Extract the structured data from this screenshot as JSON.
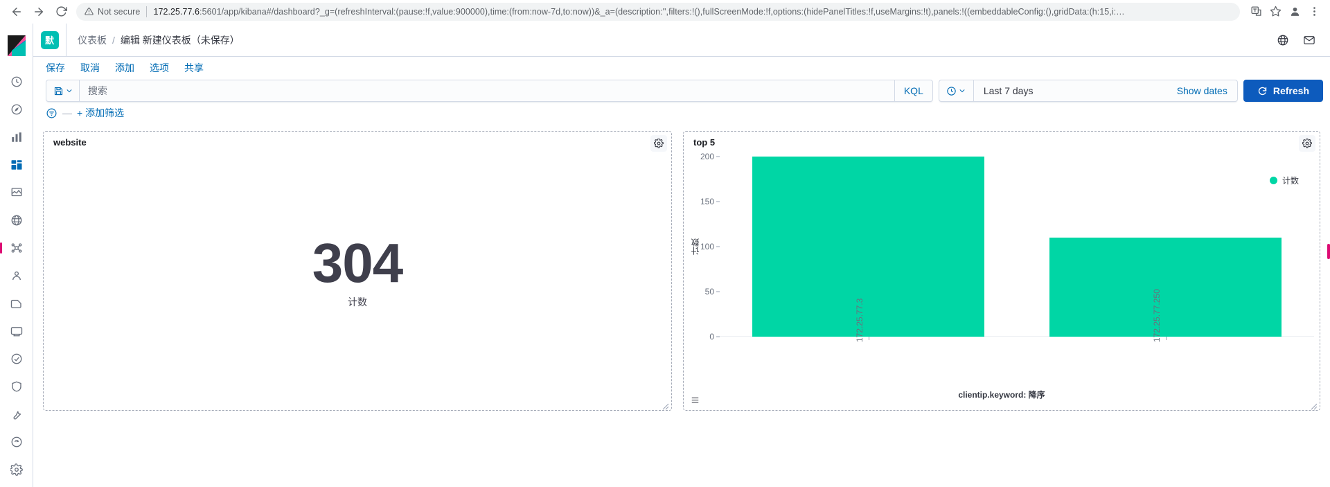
{
  "browser": {
    "back_icon": "arrow-left-icon",
    "forward_icon": "arrow-right-icon",
    "reload_icon": "reload-icon",
    "security_label": "Not secure",
    "url_host": "172.25.77.6",
    "url_rest": ":5601/app/kibana#/dashboard?_g=(refreshInterval:(pause:!f,value:900000),time:(from:now-7d,to:now))&_a=(description:'',filters:!(),fullScreenMode:!f,options:(hidePanelTitles:!f,useMargins:!t),panels:!((embeddableConfig:(),gridData:(h:15,i:…",
    "translate_icon": "translate-icon",
    "bookmark_icon": "star-icon",
    "profile_icon": "person-icon",
    "menu_icon": "kebab-menu-icon"
  },
  "sidebar": {
    "logo": "elastic-kibana-logo",
    "items": [
      {
        "name": "recently-viewed",
        "icon": "clock-icon"
      },
      {
        "name": "discover",
        "icon": "compass-icon"
      },
      {
        "name": "visualize",
        "icon": "bar-chart-icon"
      },
      {
        "name": "dashboard",
        "icon": "dashboard-icon"
      },
      {
        "name": "canvas",
        "icon": "canvas-icon"
      },
      {
        "name": "maps",
        "icon": "globe-pin-icon"
      },
      {
        "name": "machine-learning",
        "icon": "ml-icon"
      },
      {
        "name": "infrastructure",
        "icon": "infra-icon"
      },
      {
        "name": "logs",
        "icon": "logs-icon"
      },
      {
        "name": "apm",
        "icon": "apm-icon"
      },
      {
        "name": "uptime",
        "icon": "uptime-icon"
      },
      {
        "name": "siem",
        "icon": "siem-icon"
      },
      {
        "name": "dev-tools",
        "icon": "wrench-icon"
      },
      {
        "name": "monitoring",
        "icon": "monitoring-icon"
      },
      {
        "name": "management",
        "icon": "gear-icon"
      }
    ]
  },
  "header": {
    "space_badge": "默",
    "breadcrumb_root": "仪表板",
    "breadcrumb_sep": "/",
    "breadcrumb_current": "编辑 新建仪表板（未保存）",
    "globe_icon": "globe-icon",
    "mail_icon": "mail-icon"
  },
  "topmenu": {
    "items": [
      {
        "label": "保存",
        "name": "save"
      },
      {
        "label": "取消",
        "name": "cancel"
      },
      {
        "label": "添加",
        "name": "add"
      },
      {
        "label": "选项",
        "name": "options"
      },
      {
        "label": "共享",
        "name": "share"
      }
    ]
  },
  "querybar": {
    "saved_query_icon": "save-disk-icon",
    "saved_query_chevron": "chevron-down-icon",
    "search_placeholder": "搜索",
    "search_value": "",
    "language": "KQL",
    "date_quick_icon": "clock-icon",
    "date_quick_chevron": "chevron-down-icon",
    "date_range": "Last 7 days",
    "show_dates": "Show dates",
    "refresh_label": "Refresh",
    "refresh_icon": "refresh-icon",
    "refresh_color": "#0d5bbd"
  },
  "filterbar": {
    "filter_icon": "filter-icon",
    "dash": "—",
    "add_filter": "+ 添加筛选"
  },
  "panels": {
    "left": {
      "title": "website",
      "gear_icon": "gear-icon",
      "metric_value": "304",
      "metric_label": "计数"
    },
    "right": {
      "title": "top 5",
      "gear_icon": "gear-icon",
      "legend_icon": "legend-list-icon"
    }
  },
  "chart_data": {
    "type": "bar",
    "title": "top 5",
    "categories": [
      "172.25.77.3",
      "172.25.77.250"
    ],
    "values": [
      200,
      110
    ],
    "series": [
      {
        "name": "计数",
        "values": [
          200,
          110
        ],
        "color": "#00d6a5"
      }
    ],
    "xlabel": "clientip.keyword: 降序",
    "ylabel": "计数",
    "ylim": [
      0,
      200
    ],
    "yticks": [
      0,
      50,
      100,
      150,
      200
    ],
    "grid": false,
    "legend": {
      "position": "top-right",
      "entries": [
        "计数"
      ]
    }
  }
}
